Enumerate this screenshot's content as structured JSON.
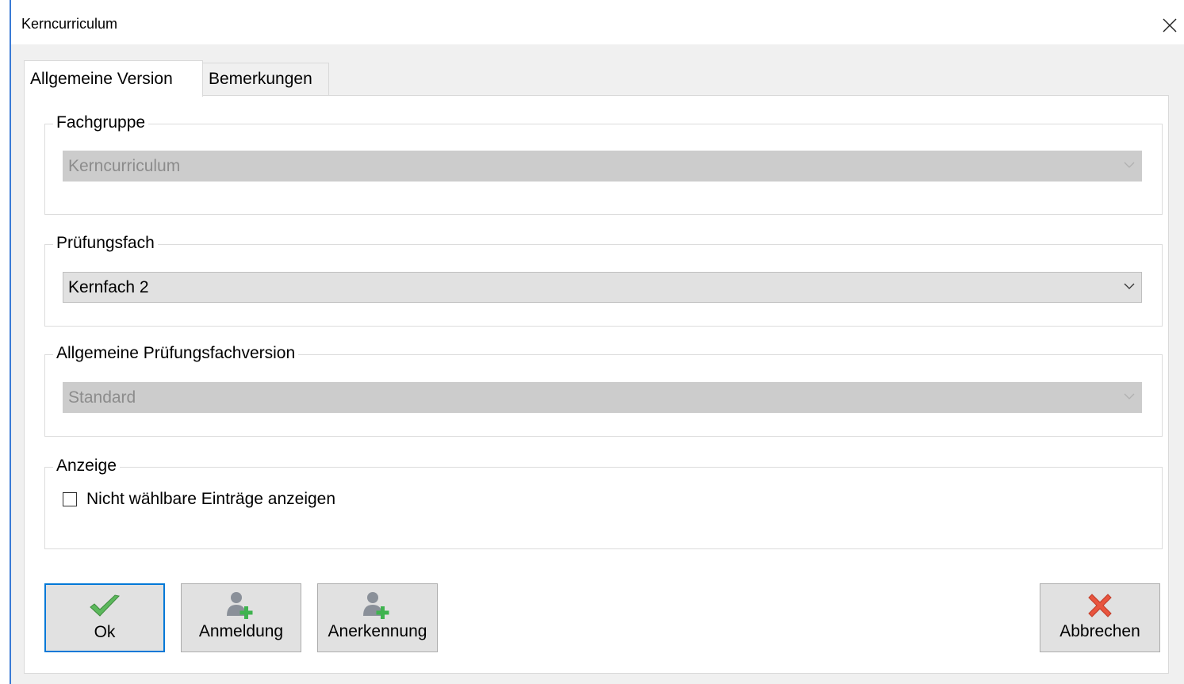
{
  "window": {
    "title": "Kerncurriculum"
  },
  "tabs": [
    {
      "label": "Allgemeine Version",
      "active": true
    },
    {
      "label": "Bemerkungen",
      "active": false
    }
  ],
  "groups": {
    "fachgruppe": {
      "label": "Fachgruppe",
      "value": "Kerncurriculum",
      "enabled": false
    },
    "pruefungsfach": {
      "label": "Prüfungsfach",
      "value": "Kernfach 2",
      "enabled": true
    },
    "pruefungsfachversion": {
      "label": "Allgemeine Prüfungsfachversion",
      "value": "Standard",
      "enabled": false
    },
    "anzeige": {
      "label": "Anzeige",
      "checkbox_label": "Nicht wählbare Einträge anzeigen",
      "checked": false
    }
  },
  "buttons": {
    "ok": {
      "label": "Ok",
      "icon": "checkmark-icon"
    },
    "anmeldung": {
      "label": "Anmeldung",
      "icon": "user-add-icon"
    },
    "anerkennung": {
      "label": "Anerkennung",
      "icon": "user-add-icon"
    },
    "abbrechen": {
      "label": "Abbrechen",
      "icon": "cross-icon"
    }
  },
  "colors": {
    "accent": "#0078d7",
    "check_green": "#4caf50",
    "cancel_red": "#e8553f",
    "disabled_field": "#cccccc"
  }
}
